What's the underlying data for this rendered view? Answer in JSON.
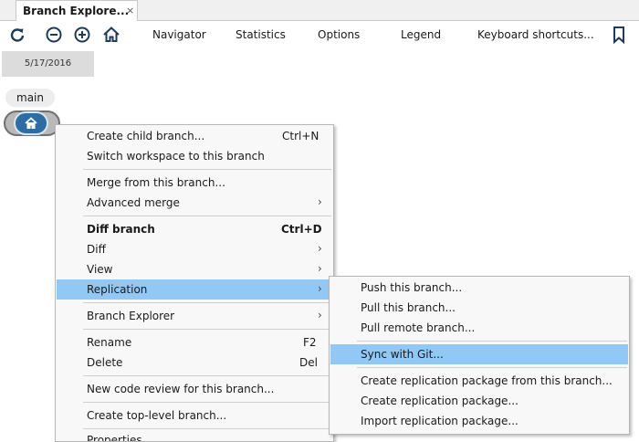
{
  "tab": {
    "title": "Branch Explore...",
    "close": "×"
  },
  "toolbar": {
    "links": [
      "Navigator",
      "Statistics",
      "Options",
      "Legend",
      "Keyboard shortcuts..."
    ]
  },
  "canvas": {
    "date": "5/17/2016",
    "branch": "main"
  },
  "context_menu": {
    "items": [
      {
        "label": "Create child branch...",
        "shortcut": "Ctrl+N"
      },
      {
        "label": "Switch workspace to this branch"
      },
      {
        "label": "Merge from this branch..."
      },
      {
        "label": "Advanced merge",
        "arrow": "›"
      },
      {
        "label": "Diff branch",
        "shortcut": "Ctrl+D"
      },
      {
        "label": "Diff",
        "arrow": "›"
      },
      {
        "label": "View",
        "arrow": "›"
      },
      {
        "label": "Replication",
        "arrow": "›"
      },
      {
        "label": "Branch Explorer",
        "arrow": "›"
      },
      {
        "label": "Rename",
        "shortcut": "F2"
      },
      {
        "label": "Delete",
        "shortcut": "Del"
      },
      {
        "label": "New code review for this branch..."
      },
      {
        "label": "Create top-level branch..."
      },
      {
        "label": "Properties"
      }
    ]
  },
  "submenu": {
    "items": [
      {
        "label": "Push this branch..."
      },
      {
        "label": "Pull this branch..."
      },
      {
        "label": "Pull remote branch..."
      },
      {
        "label": "Sync with Git..."
      },
      {
        "label": "Create replication package from this branch..."
      },
      {
        "label": "Create replication package..."
      },
      {
        "label": "Import replication package..."
      }
    ]
  },
  "colors": {
    "highlight": "#91c8f6",
    "node": "#2d6da4"
  }
}
